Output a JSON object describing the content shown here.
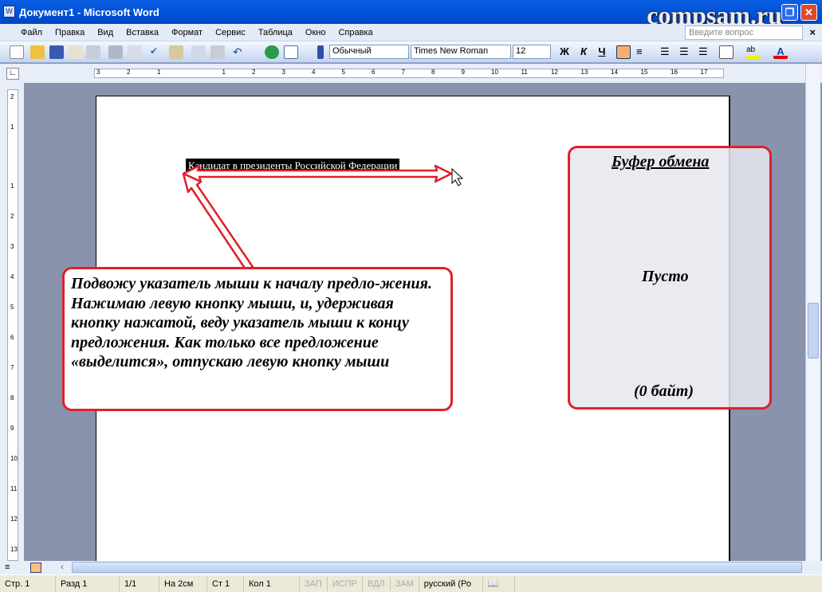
{
  "window": {
    "title": "Документ1 - Microsoft Word",
    "watermark": "compsam.ru"
  },
  "menu": [
    "Файл",
    "Правка",
    "Вид",
    "Вставка",
    "Формат",
    "Сервис",
    "Таблица",
    "Окно",
    "Справка"
  ],
  "help": {
    "placeholder": "Введите вопрос"
  },
  "toolbar": {
    "style": "Обычный",
    "font": "Times New Roman",
    "size": "12",
    "bold": "Ж",
    "italic": "К",
    "underline": "Ч"
  },
  "ruler": {
    "h_ticks": [
      "3",
      "2",
      "1",
      "1",
      "2",
      "3",
      "4",
      "5",
      "6",
      "7",
      "8",
      "9",
      "10",
      "11",
      "12",
      "13",
      "14",
      "15",
      "16",
      "17"
    ],
    "v_ticks": [
      "2",
      "1",
      "1",
      "2",
      "3",
      "4",
      "5",
      "6",
      "7",
      "8",
      "9",
      "10",
      "11",
      "12",
      "13"
    ]
  },
  "document": {
    "selected_text": "Кандидат в президенты Российской Федерации"
  },
  "callout": {
    "text": "Подвожу указатель мыши к началу предло-жения. Нажимаю левую кнопку мыши, и, удерживая кнопку нажатой, веду указатель мыши к концу предложения. Как только все предложение «выделится», отпускаю левую кнопку мыши"
  },
  "clipboard": {
    "title": "Буфер обмена",
    "empty": "Пусто",
    "size": "(0 байт)"
  },
  "status": {
    "page": "Стр. 1",
    "section": "Разд 1",
    "pages": "1/1",
    "at": "На 2см",
    "line": "Ст 1",
    "col": "Кол 1",
    "rec": "ЗАП",
    "trk": "ИСПР",
    "ext": "ВДЛ",
    "ovr": "ЗАМ",
    "lang": "русский (Ро"
  },
  "colors": {
    "accent": "#e0202a",
    "titlebar": "#0050d8"
  }
}
